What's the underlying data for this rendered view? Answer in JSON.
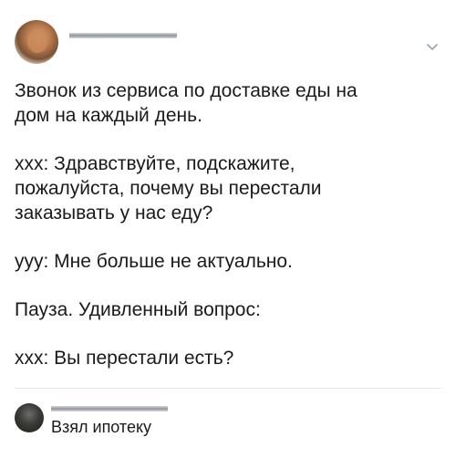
{
  "post": {
    "paragraphs": [
      "Звонок из сервиса по доставке еды на\nдом на каждый день.",
      "ххх: Здравствуйте, подскажите,\nпожалуйста, почему вы перестали\nзаказывать у нас еду?",
      "ууу: Мне больше не актуально.",
      "Пауза. Удивленный вопрос:",
      "ххх: Вы перестали есть?"
    ]
  },
  "comment": {
    "text": "Взял ипотеку"
  },
  "icons": {
    "menu": "chevron-down-icon"
  }
}
